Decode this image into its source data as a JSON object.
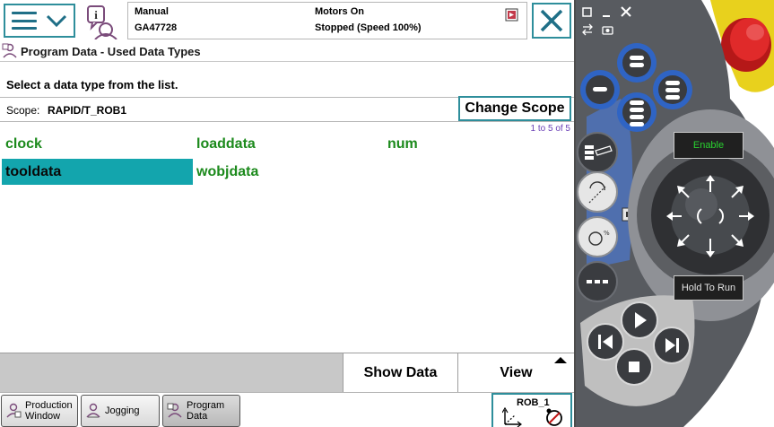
{
  "status": {
    "mode": "Manual",
    "controller": "GA47728",
    "motors": "Motors On",
    "speed": "Stopped (Speed 100%)"
  },
  "window": {
    "title": "Program Data - Used Data Types",
    "instruction": "Select a data type from the list."
  },
  "scope": {
    "label": "Scope:",
    "value": "RAPID/T_ROB1",
    "change_label": "Change Scope"
  },
  "counter": "1 to 5 of 5",
  "data_types": [
    {
      "name": "clock",
      "selected": false
    },
    {
      "name": "loaddata",
      "selected": false
    },
    {
      "name": "num",
      "selected": false
    },
    {
      "name": "tooldata",
      "selected": true
    },
    {
      "name": "wobjdata",
      "selected": false
    }
  ],
  "commands": {
    "show_data": "Show Data",
    "view": "View"
  },
  "taskbar": [
    {
      "line1": "Production",
      "line2": "Window"
    },
    {
      "line1": "Jogging",
      "line2": ""
    },
    {
      "line1": "Program",
      "line2": "Data"
    }
  ],
  "robot": {
    "name": "ROB_1"
  },
  "pendant": {
    "enable_label": "Enable",
    "hold_label": "Hold To Run"
  },
  "colors": {
    "accent": "#2e8e9b",
    "selection": "#13a5ad",
    "item_text": "#1c8a1c",
    "counter": "#6a3fb6",
    "housing": "#585b60",
    "key_blue": "#2f64c4",
    "emergency_stop": "#d92525",
    "yellow_guard": "#e8d11d"
  }
}
